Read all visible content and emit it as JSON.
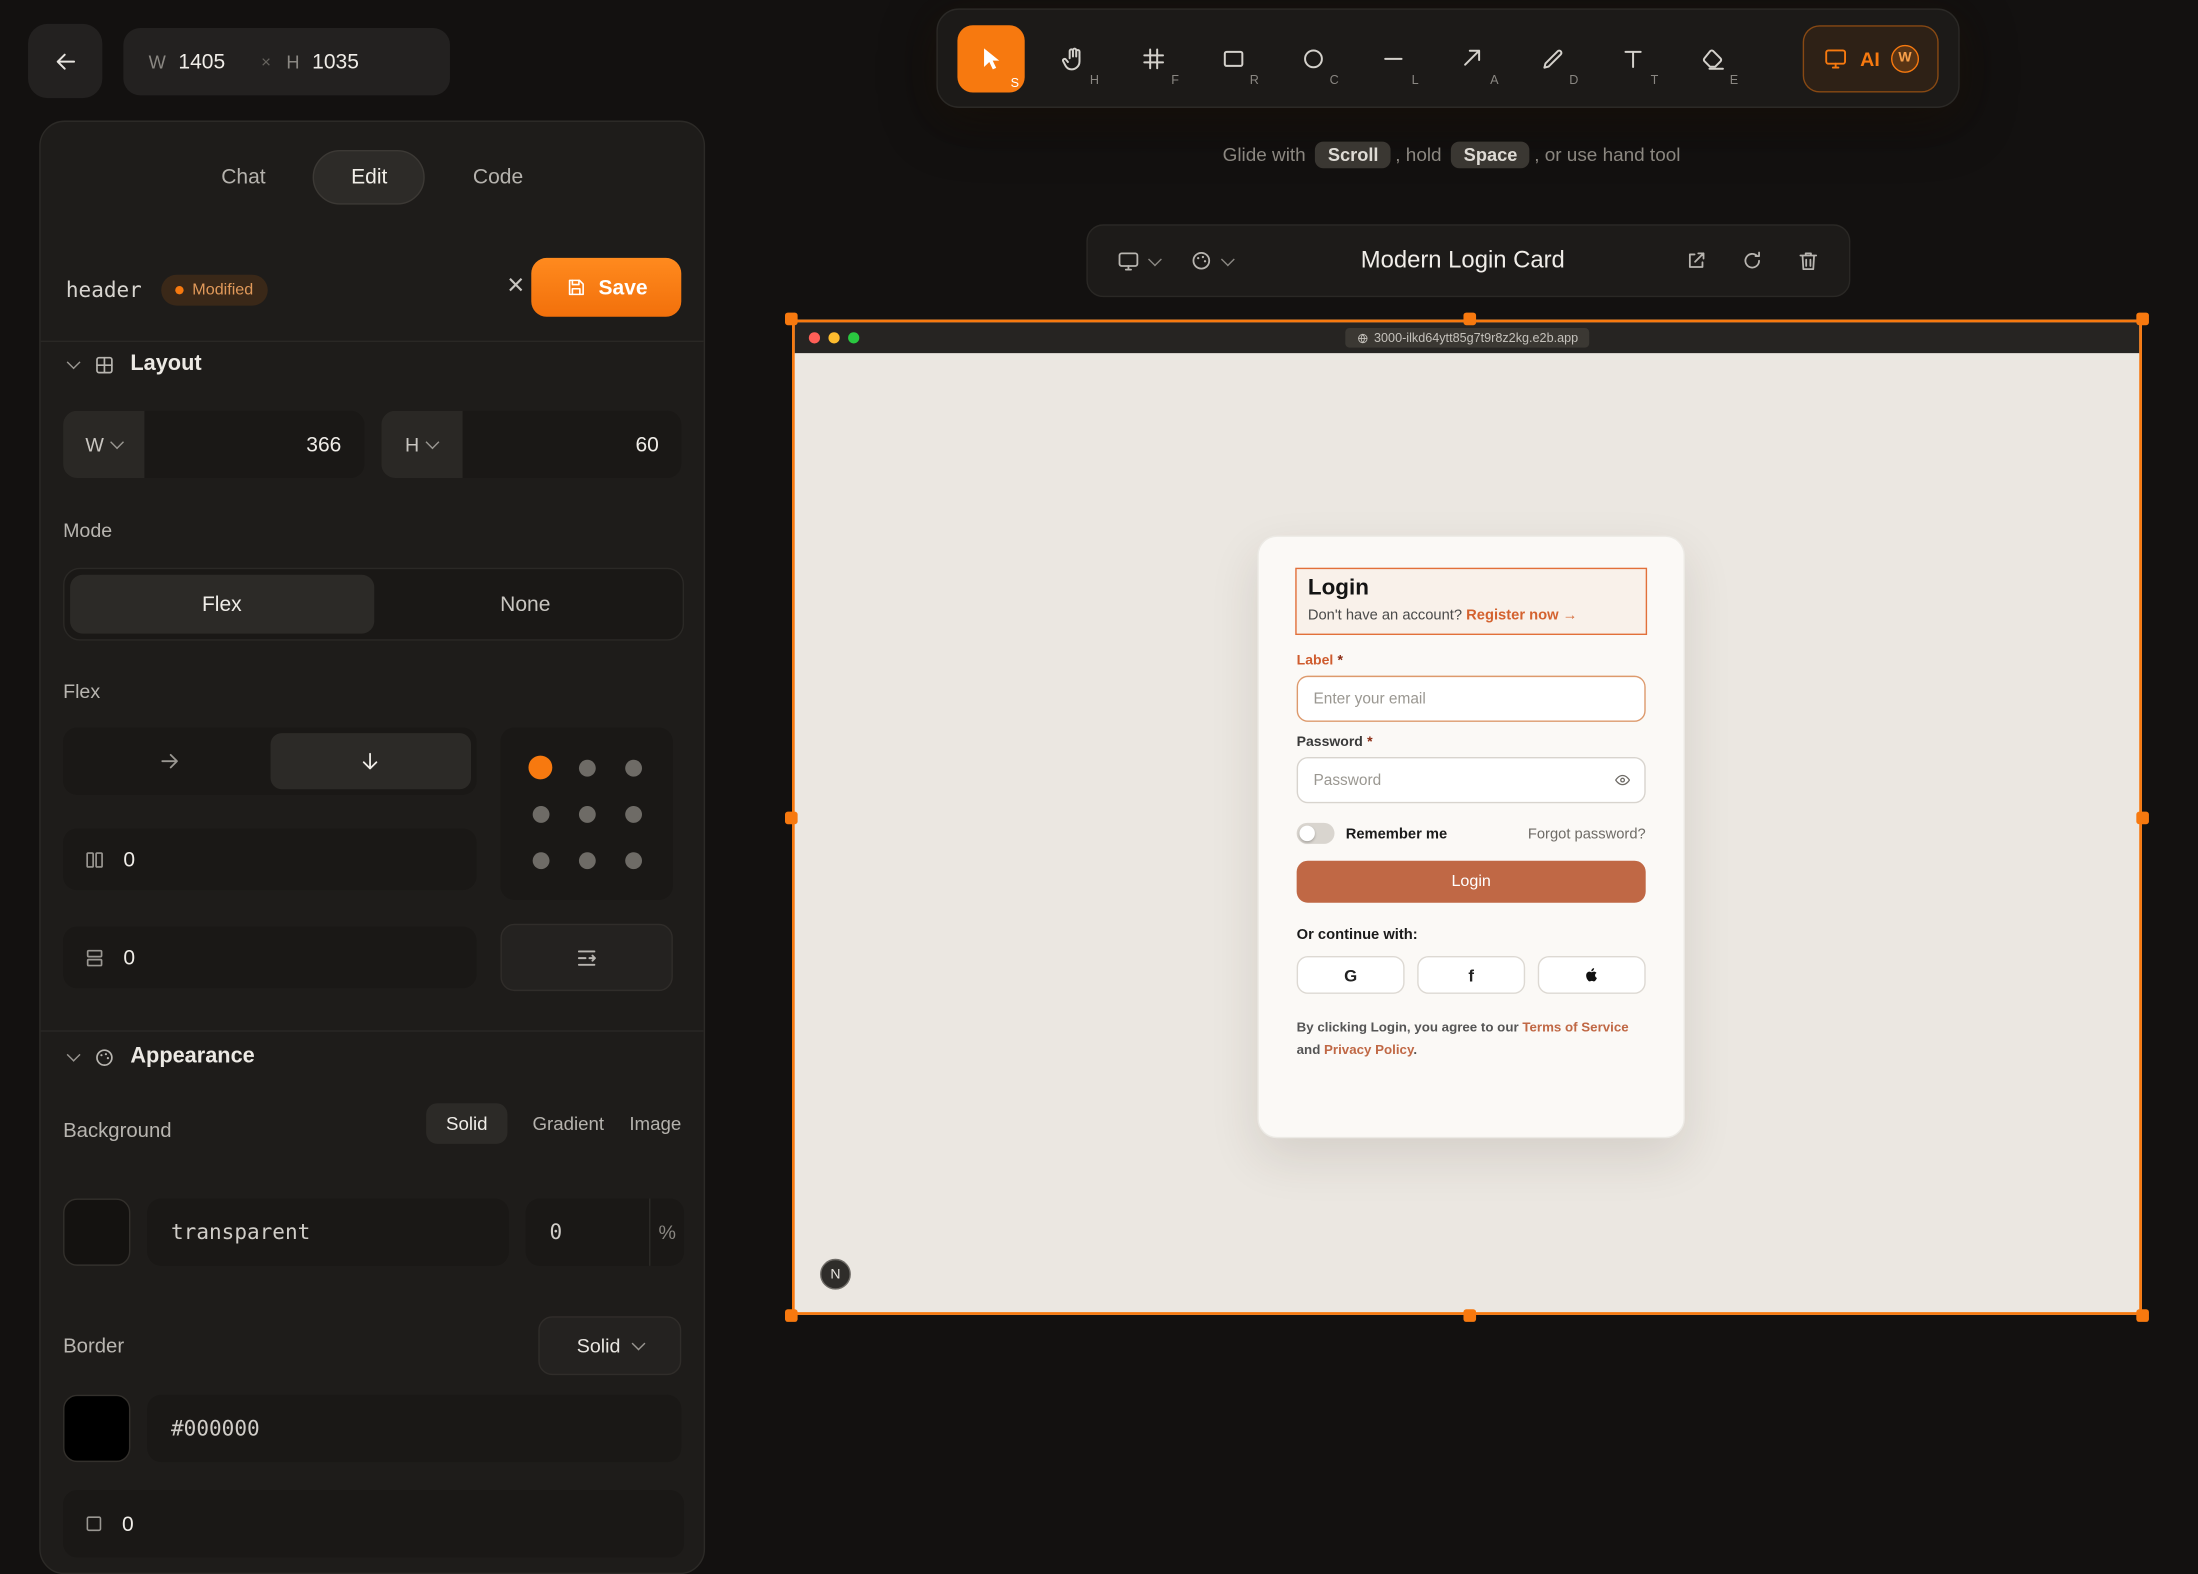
{
  "accent_color": "#f7790f",
  "terracotta_color": "#c06845",
  "topbar": {
    "dims": {
      "w_label": "W",
      "w_value": "1405",
      "times": "×",
      "h_label": "H",
      "h_value": "1035"
    },
    "tools": [
      {
        "name": "select",
        "shortcut": "S"
      },
      {
        "name": "hand",
        "shortcut": "H"
      },
      {
        "name": "frame",
        "shortcut": "F"
      },
      {
        "name": "rectangle",
        "shortcut": "R"
      },
      {
        "name": "circle",
        "shortcut": "C"
      },
      {
        "name": "line",
        "shortcut": "L"
      },
      {
        "name": "arrow",
        "shortcut": "A"
      },
      {
        "name": "draw",
        "shortcut": "D"
      },
      {
        "name": "text",
        "shortcut": "T"
      },
      {
        "name": "eraser",
        "shortcut": "E"
      }
    ],
    "ai": {
      "label": "AI",
      "badge": "W"
    },
    "hint": {
      "pre": "Glide with",
      "key_scroll": "Scroll",
      "mid": ", hold",
      "key_space": "Space",
      "post": ", or use hand tool"
    }
  },
  "canvas": {
    "window_title": "Modern Login Card",
    "url": "3000-ilkd64ytt85g7t9r8z2kg.e2b.app",
    "corner_badge": "N",
    "login": {
      "title": "Login",
      "subtitle": "Don't have an account?",
      "register": "Register now →",
      "email_label": "Label",
      "required": "*",
      "email_placeholder": "Enter your email",
      "password_label": "Password",
      "password_placeholder": "Password",
      "remember": "Remember me",
      "forgot": "Forgot password?",
      "submit": "Login",
      "continue_with": "Or continue with:",
      "social_g": "G",
      "social_f": "f",
      "legal_pre": "By clicking Login, you agree to our",
      "terms": "Terms of Service",
      "legal_and": "and",
      "privacy": "Privacy Policy",
      "legal_end": "."
    }
  },
  "panel": {
    "tabs": {
      "chat": "Chat",
      "edit": "Edit",
      "code": "Code"
    },
    "element": {
      "tag": "header",
      "status": "Modified",
      "save": "Save"
    },
    "layout": {
      "title": "Layout",
      "w_label": "W",
      "w_value": "366",
      "h_label": "H",
      "h_value": "60",
      "mode_label": "Mode",
      "mode_flex": "Flex",
      "mode_none": "None",
      "flex_label": "Flex",
      "col_gap": "0",
      "row_gap": "0"
    },
    "appearance": {
      "title": "Appearance",
      "background_label": "Background",
      "tab_solid": "Solid",
      "tab_gradient": "Gradient",
      "tab_image": "Image",
      "bg_value": "transparent",
      "bg_opacity": "0",
      "percent": "%",
      "border_label": "Border",
      "border_style": "Solid",
      "border_color": "#000000",
      "border_width": "0"
    }
  }
}
